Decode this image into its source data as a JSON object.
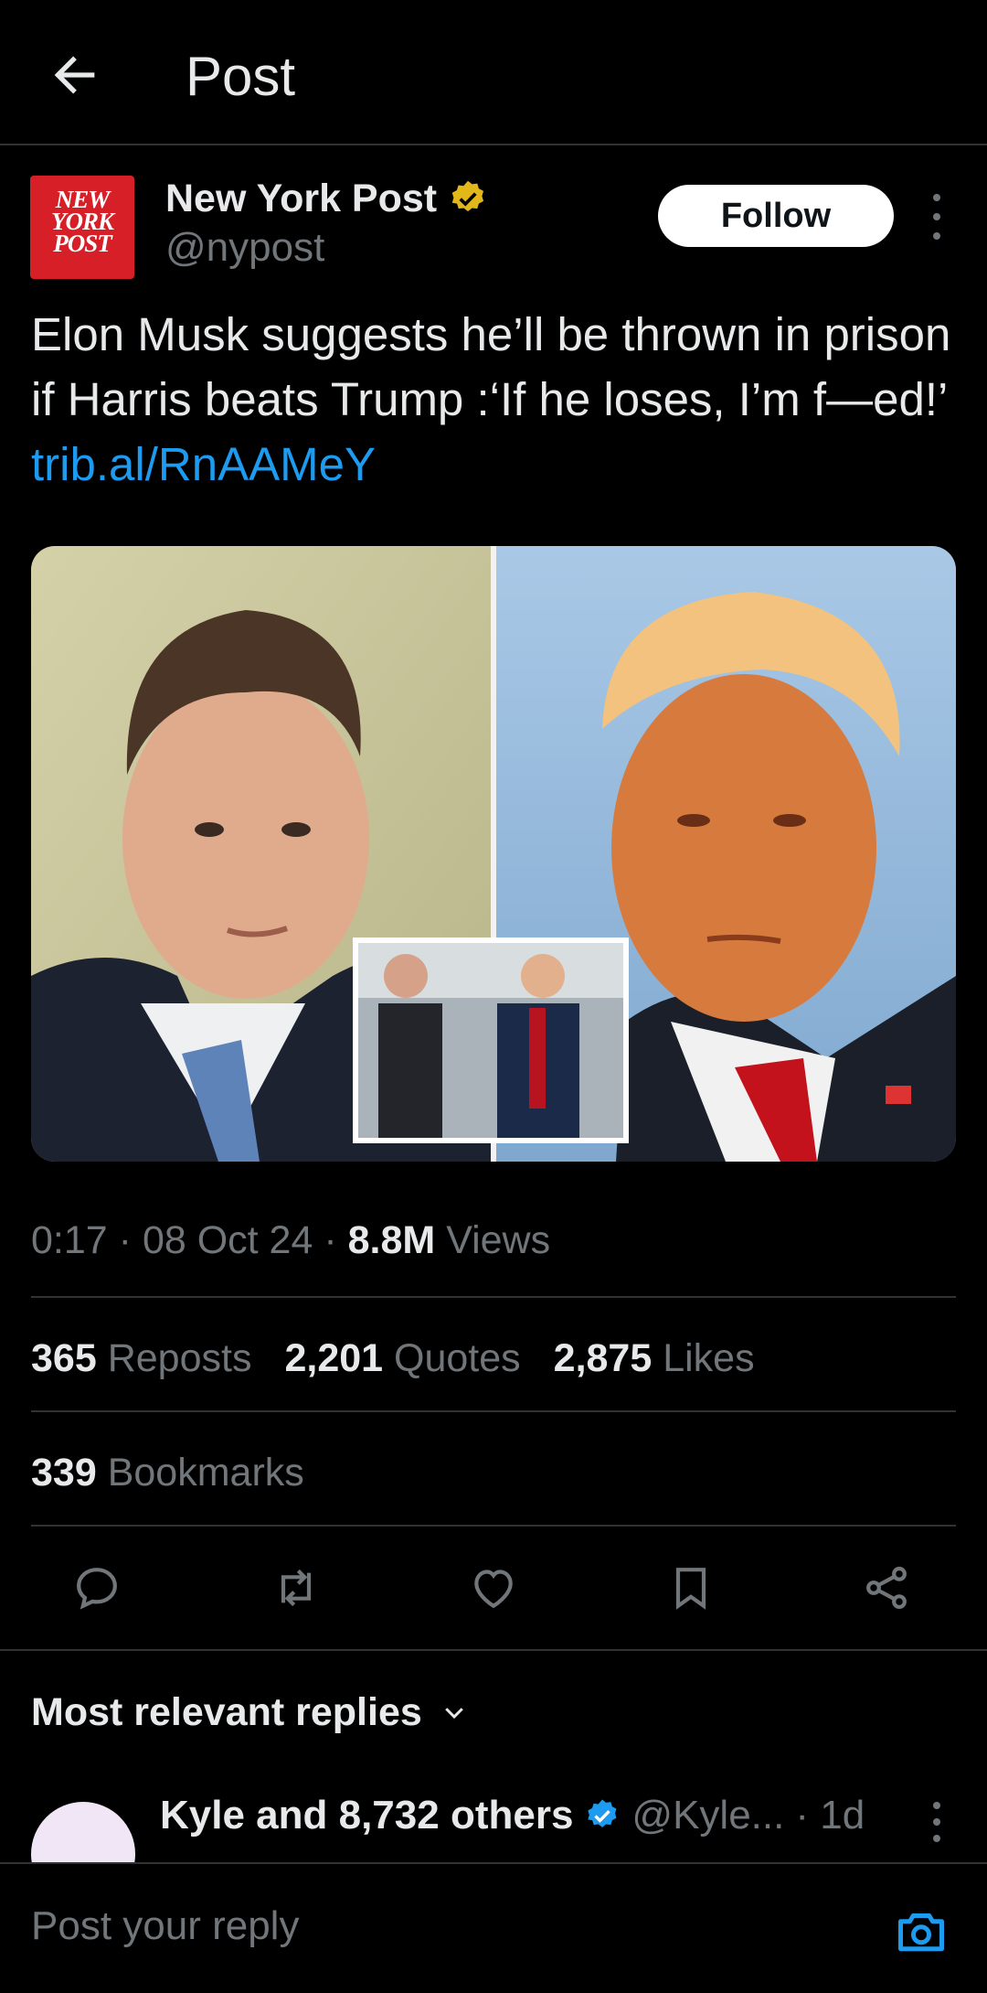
{
  "header": {
    "title": "Post"
  },
  "author": {
    "name": "New York Post",
    "handle": "@nypost",
    "logo_lines": [
      "NEW",
      "YORK",
      "POST"
    ]
  },
  "follow_label": "Follow",
  "post": {
    "text": "Elon Musk suggests he’ll be thrown in prison if Harris beats Trump :‘If he loses, I’m f—ed!’",
    "link": "trib.al/RnAAMeY"
  },
  "meta": {
    "time": "0:17",
    "date": "08 Oct 24",
    "views_count": "8.8M",
    "views_label": "Views"
  },
  "stats": {
    "reposts_count": "365",
    "reposts_label": "Reposts",
    "quotes_count": "2,201",
    "quotes_label": "Quotes",
    "likes_count": "2,875",
    "likes_label": "Likes",
    "bookmarks_count": "339",
    "bookmarks_label": "Bookmarks"
  },
  "actions": [
    "reply-icon",
    "repost-icon",
    "like-icon",
    "bookmark-icon",
    "share-icon"
  ],
  "replies_sort": {
    "label": "Most relevant replies"
  },
  "reply": {
    "name": "Kyle and 8,732 others",
    "handle": "@Kyle...",
    "time": "· 1d"
  },
  "composer": {
    "placeholder": "Post your reply"
  },
  "colors": {
    "accent": "#1d9bf0",
    "verified_gold": "#e2b719",
    "brand_red": "#d61f26"
  }
}
